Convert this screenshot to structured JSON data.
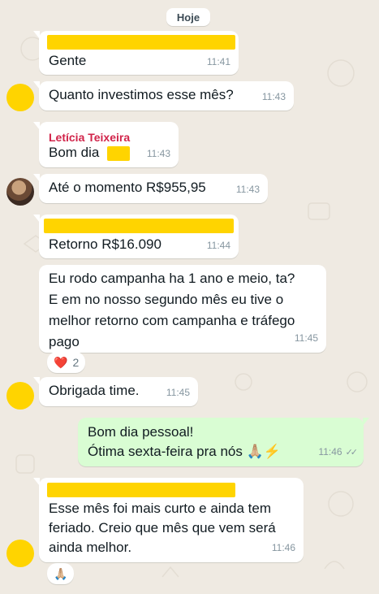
{
  "day_label": "Hoje",
  "messages": [
    {
      "text": "Gente",
      "time": "11:41"
    },
    {
      "text": "Quanto investimos esse mês?",
      "time": "11:43"
    },
    {
      "sender": "Letícia Teixeira",
      "text": "Bom dia",
      "time": "11:43"
    },
    {
      "text": "Até o momento R$955,95",
      "time": "11:43"
    },
    {
      "text": "Retorno R$16.090",
      "time": "11:44"
    },
    {
      "lines": [
        "Eu rodo campanha ha 1 ano e meio, ta?",
        "E em no nosso segundo mês eu tive o",
        "melhor retorno com campanha e tráfego",
        "pago"
      ],
      "time": "11:45",
      "reaction": {
        "emoji": "❤️",
        "count": "2"
      }
    },
    {
      "text": "Obrigada time.",
      "time": "11:45"
    },
    {
      "lines": [
        "Bom dia pessoal!",
        "Ótima sexta-feira pra nós 🙏🏼⚡"
      ],
      "time": "11:46",
      "status": "read-ticks"
    },
    {
      "lines": [
        "Esse mês foi mais curto e ainda tem",
        "feriado. Creio que mês que vem será",
        "ainda melhor."
      ],
      "time": "11:46",
      "reaction": {
        "emoji": "🙏🏼"
      }
    }
  ],
  "colors": {
    "incoming": "#ffffff",
    "outgoing": "#d9fdd3",
    "background": "#efeae2",
    "redaction": "#ffd400",
    "sender_name": "#d1244a"
  }
}
